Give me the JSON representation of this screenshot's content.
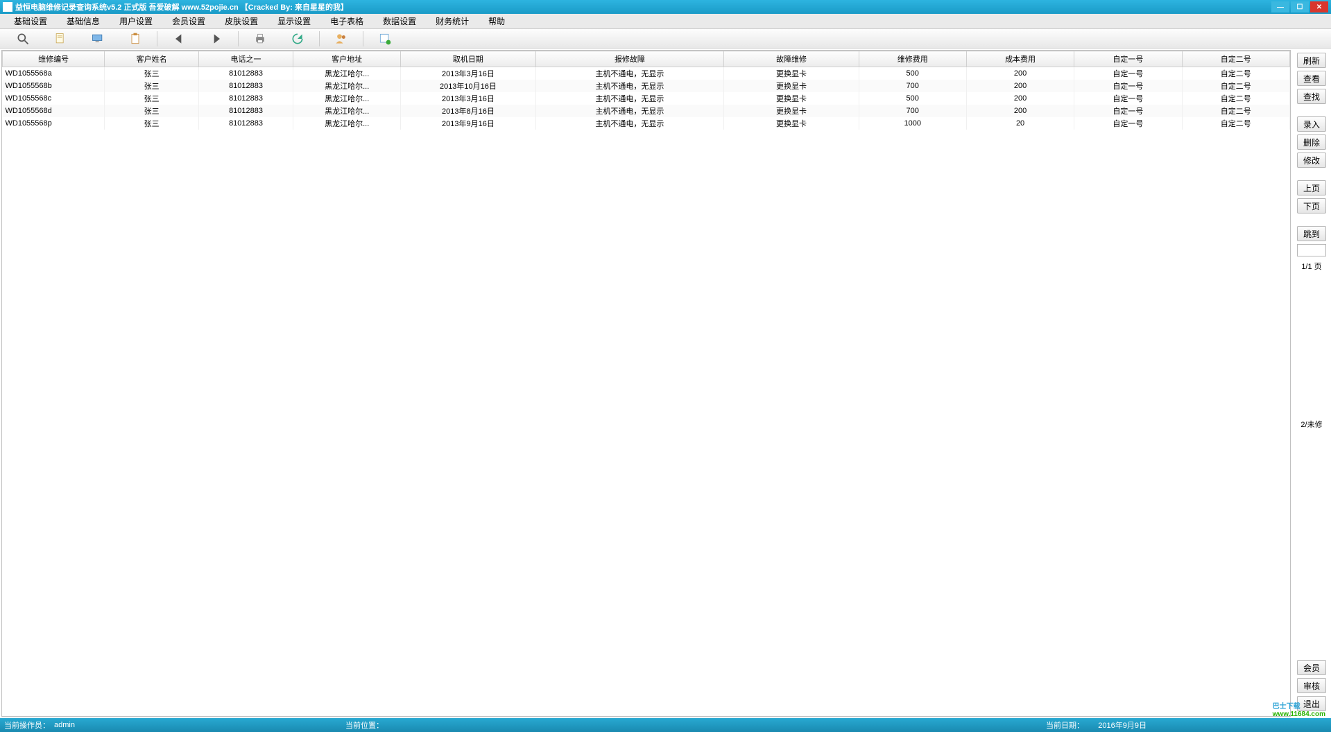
{
  "title": "益恒电脑维修记录查询系统v5.2  正式版  吾爱破解  www.52pojie.cn  【Cracked By: 来自星星的我】",
  "menu": [
    "基础设置",
    "基础信息",
    "用户设置",
    "会员设置",
    "皮肤设置",
    "显示设置",
    "电子表格",
    "数据设置",
    "财务统计",
    "帮助"
  ],
  "columns": [
    "维修编号",
    "客户姓名",
    "电话之一",
    "客户地址",
    "取机日期",
    "报修故障",
    "故障维修",
    "维修费用",
    "成本费用",
    "自定一号",
    "自定二号"
  ],
  "rows": [
    {
      "id": "WD1055568a",
      "name": "张三",
      "phone": "81012883",
      "addr": "黑龙江哈尔...",
      "date": "2013年3月16日",
      "fault": "主机不通电，无显示",
      "fix": "更换显卡",
      "fee": "500",
      "cost": "200",
      "c1": "自定一号",
      "c2": "自定二号"
    },
    {
      "id": "WD1055568b",
      "name": "张三",
      "phone": "81012883",
      "addr": "黑龙江哈尔...",
      "date": "2013年10月16日",
      "fault": "主机不通电，无显示",
      "fix": "更换显卡",
      "fee": "700",
      "cost": "200",
      "c1": "自定一号",
      "c2": "自定二号"
    },
    {
      "id": "WD1055568c",
      "name": "张三",
      "phone": "81012883",
      "addr": "黑龙江哈尔...",
      "date": "2013年3月16日",
      "fault": "主机不通电，无显示",
      "fix": "更换显卡",
      "fee": "500",
      "cost": "200",
      "c1": "自定一号",
      "c2": "自定二号"
    },
    {
      "id": "WD1055568d",
      "name": "张三",
      "phone": "81012883",
      "addr": "黑龙江哈尔...",
      "date": "2013年8月16日",
      "fault": "主机不通电，无显示",
      "fix": "更换显卡",
      "fee": "700",
      "cost": "200",
      "c1": "自定一号",
      "c2": "自定二号"
    },
    {
      "id": "WD1055568p",
      "name": "张三",
      "phone": "81012883",
      "addr": "黑龙江哈尔...",
      "date": "2013年9月16日",
      "fault": "主机不通电，无显示",
      "fix": "更换显卡",
      "fee": "1000",
      "cost": "20",
      "c1": "自定一号",
      "c2": "自定二号"
    }
  ],
  "right": {
    "refresh": "刷新",
    "view": "查看",
    "find": "查找",
    "input": "录入",
    "delete": "删除",
    "modify": "修改",
    "prev": "上页",
    "next": "下页",
    "jump": "跳到",
    "page_label": "1/1 页",
    "status": "2/未修",
    "member": "会员",
    "audit": "审核",
    "exit": "退出"
  },
  "status": {
    "operator_label": "当前操作员：",
    "operator": "admin",
    "pos_label": "当前位置：",
    "date_label": "当前日期：",
    "date": "2016年9月9日"
  },
  "watermark": {
    "line1": "巴士下载",
    "line2": "www.11684.com"
  }
}
